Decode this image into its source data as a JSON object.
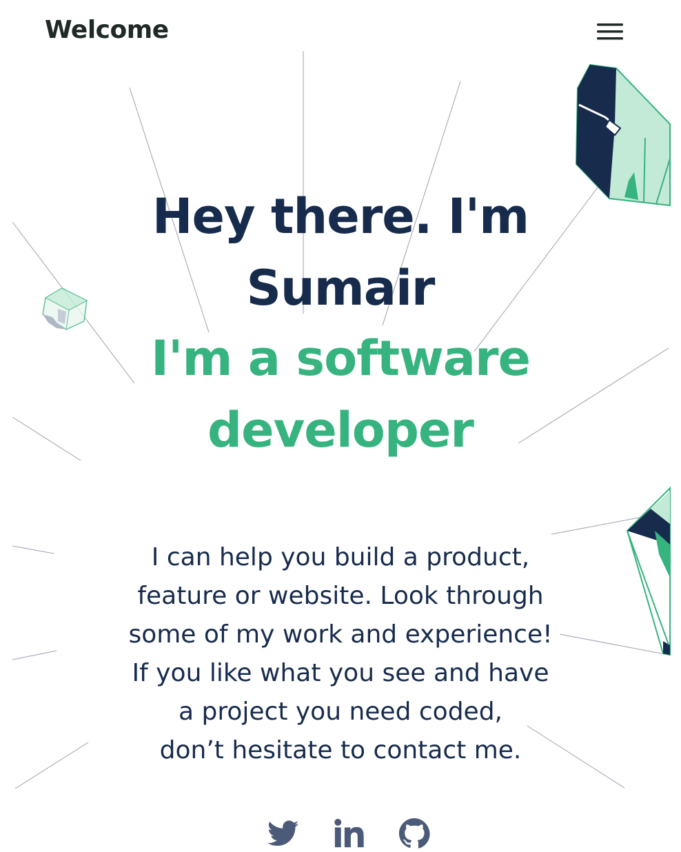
{
  "header": {
    "brand": "Welcome",
    "menu_icon": "hamburger-menu-icon"
  },
  "hero": {
    "title_lines": [
      "Hey there. I'm",
      "Sumair"
    ],
    "subtitle_lines": [
      "I'm a software",
      "developer"
    ]
  },
  "intro": {
    "lines": [
      "I can help you build a product,",
      "feature or website. Look through",
      "some of my work and experience!",
      "If you like what you see and have",
      "a project you need coded,",
      "don’t hesitate to contact me."
    ]
  },
  "social": [
    {
      "name": "Twitter",
      "icon": "twitter-icon"
    },
    {
      "name": "LinkedIn",
      "icon": "linkedin-icon"
    },
    {
      "name": "GitHub",
      "icon": "github-icon"
    }
  ],
  "colors": {
    "navy": "#172b4d",
    "green": "#36b37e",
    "mint": "#c3ead6",
    "social_icon": "#4a5a78",
    "rays": "#9aa0ad"
  }
}
